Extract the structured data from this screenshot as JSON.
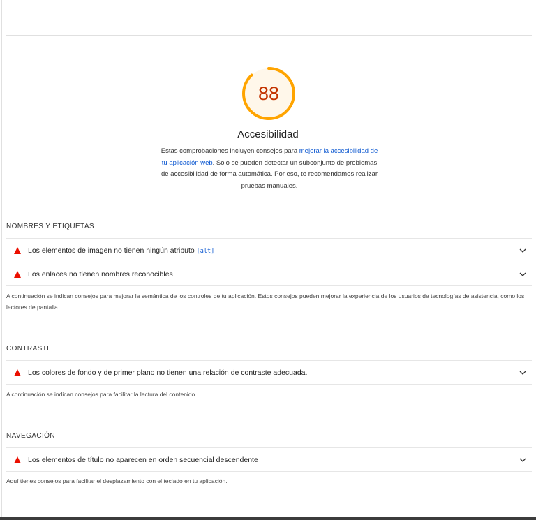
{
  "category": {
    "score": "88",
    "title": "Accesibilidad",
    "desc_before": "Estas comprobaciones incluyen consejos para ",
    "desc_link": "mejorar la accesibilidad de tu aplicación web",
    "desc_after": ". Solo se pueden detectar un subconjunto de problemas de accesibilidad de forma automática. Por eso, te recomendamos realizar pruebas manuales.",
    "score_color": "#ffa400",
    "score_text_color": "#c33300",
    "fail_color": "#eb0f00"
  },
  "groups": {
    "names": {
      "title": "NOMBRES Y ETIQUETAS",
      "audits": [
        {
          "label": "Los elementos de imagen no tienen ningún atributo ",
          "code": "[alt]"
        },
        {
          "label": "Los enlaces no tienen nombres reconocibles"
        }
      ],
      "description": "A continuación se indican consejos para mejorar la semántica de los controles de tu aplicación. Estos consejos pueden mejorar la experiencia de los usuarios de tecnologías de asistencia, como los lectores de pantalla."
    },
    "contrast": {
      "title": "CONTRASTE",
      "audits": [
        {
          "label": "Los colores de fondo y de primer plano no tienen una relación de contraste adecuada."
        }
      ],
      "description": "A continuación se indican consejos para facilitar la lectura del contenido."
    },
    "navigation": {
      "title": "NAVEGACIÓN",
      "audits": [
        {
          "label": "Los elementos de título no aparecen en orden secuencial descendente"
        }
      ],
      "description": "Aquí tienes consejos para facilitar el desplazamiento con el teclado en tu aplicación."
    }
  },
  "icons": {
    "fail": "warning-triangle-icon",
    "expand": "chevron-down-icon"
  }
}
